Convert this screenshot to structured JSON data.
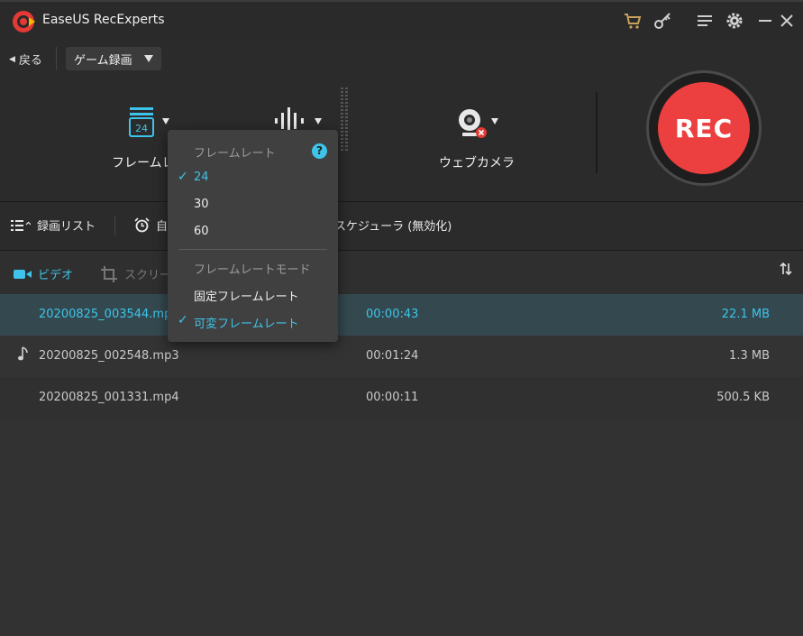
{
  "window": {
    "title": "EaseUS RecExperts"
  },
  "nav": {
    "back_label": "戻る",
    "mode_selected": "ゲーム録画"
  },
  "controls": {
    "framerate_label": "フレームレ",
    "framerate_value": "24",
    "webcam_label": "ウェブカメラ",
    "rec_label": "REC"
  },
  "toolbar": {
    "list_label": "録画リスト",
    "auto_label": "自",
    "scheduler_label": "スケジューラ (無効化)"
  },
  "tabs": {
    "video": "ビデオ",
    "screenshot": "スクリー"
  },
  "recordings": [
    {
      "name": "20200825_003544.mp",
      "duration": "00:00:43",
      "size": "22.1 MB",
      "type": "video",
      "selected": true
    },
    {
      "name": "20200825_002548.mp3",
      "duration": "00:01:24",
      "size": "1.3 MB",
      "type": "audio",
      "selected": false
    },
    {
      "name": "20200825_001331.mp4",
      "duration": "00:00:11",
      "size": "500.5 KB",
      "type": "video",
      "selected": false
    }
  ],
  "framerate_popup": {
    "header": "フレームレート",
    "options": [
      "24",
      "30",
      "60"
    ],
    "selected_option": "24",
    "mode_header": "フレームレートモード",
    "mode_options": [
      "固定フレームレート",
      "可変フレームレート"
    ],
    "selected_mode": "可変フレームレート",
    "check_mark": "✓",
    "help_symbol": "?"
  },
  "colors": {
    "accent": "#3ec3ea",
    "rec": "#ec3f3f",
    "background": "#2b2b2b",
    "selected_row": "#34494f"
  },
  "icons": [
    "app-logo-icon",
    "cart-icon",
    "key-icon",
    "menu-icon",
    "gear-icon",
    "minimize-icon",
    "close-icon",
    "framerate-icon",
    "audio-icon",
    "webcam-icon",
    "list-icon",
    "alarm-icon",
    "video-icon",
    "crop-icon",
    "sort-icon",
    "music-note-icon"
  ]
}
